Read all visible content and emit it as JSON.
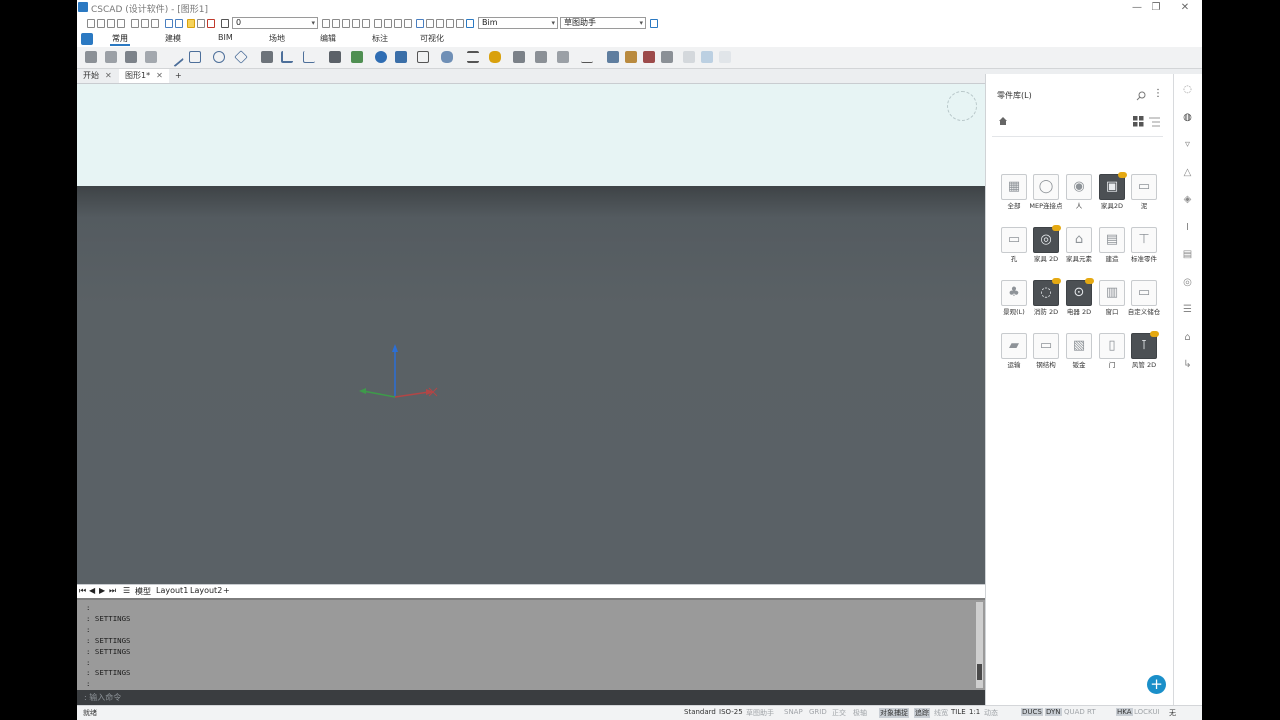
{
  "window": {
    "title": "CSCAD (设计软件) - [图形1]",
    "controls": [
      "—",
      "❐",
      "✕"
    ]
  },
  "quickbar": {
    "layer_value": "0",
    "style_value": "Bim",
    "tool_value": "草图助手"
  },
  "ribbon": {
    "tabs": [
      "常用",
      "建模",
      "BIM",
      "场地",
      "编辑",
      "标注",
      "可视化"
    ],
    "active_tab": "常用"
  },
  "doc_tabs": [
    {
      "label": "开始",
      "close": "✕"
    },
    {
      "label": "图形1*",
      "close": "✕",
      "active": true
    }
  ],
  "doc_tabs_add": "+",
  "layout_tabs": {
    "nav": [
      "⏮",
      "◀",
      "▶",
      "⏭"
    ],
    "items": [
      "模型",
      "Layout1",
      "Layout2"
    ],
    "add": "+"
  },
  "command": {
    "history": [
      ":",
      ": SETTINGS",
      ":",
      ": SETTINGS",
      ": SETTINGS",
      ":",
      ": SETTINGS",
      ":"
    ],
    "prompt": ": 输入命令"
  },
  "statusbar": {
    "left_text": "就绪",
    "items": [
      {
        "label": "Standard",
        "state": "normal"
      },
      {
        "label": "ISO-25",
        "state": "normal"
      },
      {
        "label": "草图助手",
        "state": "off"
      },
      {
        "label": "SNAP",
        "state": "off"
      },
      {
        "label": "GRID",
        "state": "off"
      },
      {
        "label": "正交",
        "state": "off"
      },
      {
        "label": "极轴",
        "state": "off"
      },
      {
        "label": "对象捕捉",
        "state": "on"
      },
      {
        "label": "追踪",
        "state": "on"
      },
      {
        "label": "线宽",
        "state": "off"
      },
      {
        "label": "TILE",
        "state": "normal"
      },
      {
        "label": "1:1",
        "state": "normal"
      },
      {
        "label": "动态",
        "state": "off"
      },
      {
        "label": "DUCS",
        "state": "on"
      },
      {
        "label": "DYN",
        "state": "on"
      },
      {
        "label": "QUAD",
        "state": "off"
      },
      {
        "label": "RT",
        "state": "off"
      },
      {
        "label": "HKA",
        "state": "on"
      },
      {
        "label": "LOCKUI",
        "state": "off"
      },
      {
        "label": "无",
        "state": "normal"
      }
    ]
  },
  "parts_library": {
    "title": "零件库(L)",
    "icons": {
      "search": "search-icon",
      "more": "more-icon",
      "home": "home-icon",
      "grid_view": "grid-view-icon",
      "list_view": "list-view-icon"
    },
    "items": [
      {
        "label": "全部",
        "dark": false,
        "badge": false,
        "icon": "grid-icon"
      },
      {
        "label": "MEP连接点",
        "dark": false,
        "badge": false,
        "icon": "circle-icon"
      },
      {
        "label": "人",
        "dark": false,
        "badge": false,
        "icon": "people-icon"
      },
      {
        "label": "家具2D",
        "dark": true,
        "badge": true,
        "icon": "furniture-icon"
      },
      {
        "label": "泥",
        "dark": false,
        "badge": false,
        "icon": "folder-icon"
      },
      {
        "label": "孔",
        "dark": false,
        "badge": false,
        "icon": "folder-icon"
      },
      {
        "label": "家具 2D",
        "dark": true,
        "badge": true,
        "icon": "lamp-icon"
      },
      {
        "label": "家具元素",
        "dark": false,
        "badge": false,
        "icon": "chair-icon"
      },
      {
        "label": "建造",
        "dark": false,
        "badge": false,
        "icon": "block-icon"
      },
      {
        "label": "标准零件",
        "dark": false,
        "badge": false,
        "icon": "bolt-icon"
      },
      {
        "label": "景观(L)",
        "dark": false,
        "badge": false,
        "icon": "tree-icon"
      },
      {
        "label": "消防 2D",
        "dark": true,
        "badge": true,
        "icon": "fire-icon"
      },
      {
        "label": "电器 2D",
        "dark": true,
        "badge": true,
        "icon": "electric-icon"
      },
      {
        "label": "窗口",
        "dark": false,
        "badge": false,
        "icon": "window-icon"
      },
      {
        "label": "自定义储仓",
        "dark": false,
        "badge": false,
        "icon": "folder-icon"
      },
      {
        "label": "运输",
        "dark": false,
        "badge": false,
        "icon": "truck-icon"
      },
      {
        "label": "钢结构",
        "dark": false,
        "badge": false,
        "icon": "folder-icon"
      },
      {
        "label": "钣金",
        "dark": false,
        "badge": false,
        "icon": "sheet-icon"
      },
      {
        "label": "门",
        "dark": false,
        "badge": false,
        "icon": "door-icon"
      },
      {
        "label": "风管 2D",
        "dark": true,
        "badge": true,
        "icon": "duct-icon"
      }
    ],
    "add_label": "+"
  },
  "right_strip": [
    "bulb-icon",
    "bulb-active-icon",
    "lamp-icon",
    "warning-icon",
    "layers-icon",
    "beam-icon",
    "panel-icon",
    "globe-icon",
    "settings-icon",
    "house-icon",
    "stairs-icon"
  ],
  "colors": {
    "accent": "#2b79c2",
    "viewport_sky": "#e7f4f4",
    "viewport_ground": "#5a6166",
    "command_bg": "#9a9a9a",
    "add_button": "#1a8fc9",
    "badge": "#e5a912"
  }
}
